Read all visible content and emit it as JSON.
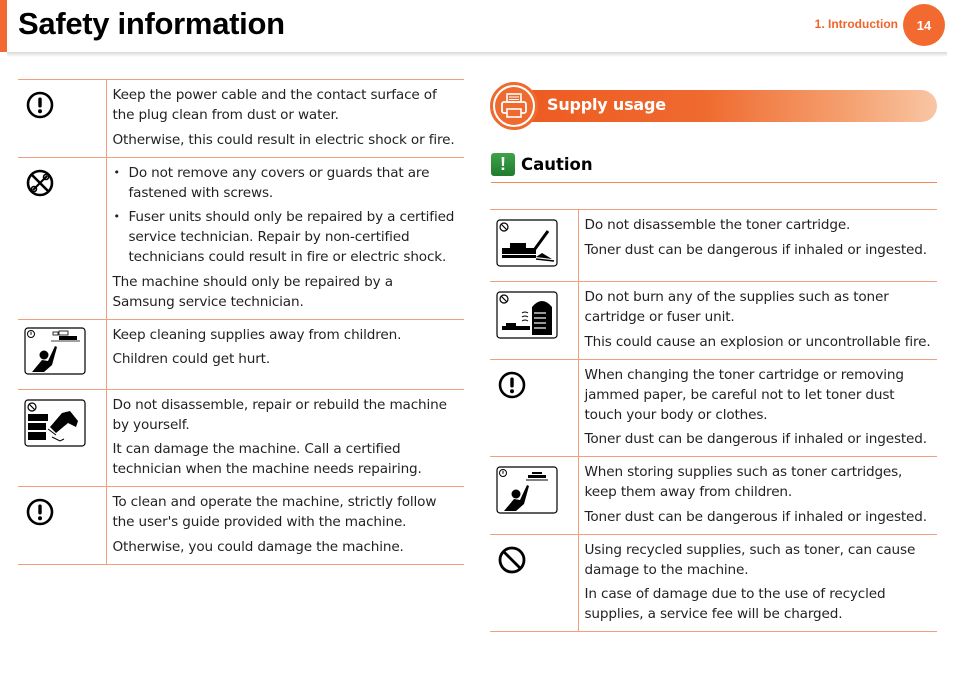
{
  "header": {
    "title": "Safety information",
    "chapter": "1.  Introduction",
    "page_number": "14",
    "accent_color": "#f26a30"
  },
  "left_table": {
    "rows": [
      {
        "icon": "mandatory-exclamation-icon",
        "paragraphs": [
          "Keep the power cable and the contact surface of the plug clean from dust or water.",
          "Otherwise, this could result in electric shock or fire."
        ]
      },
      {
        "icon": "no-tools-icon",
        "bullets": [
          "Do not remove any covers or guards that are fastened with screws.",
          "Fuser units should only be repaired by a certified service technician. Repair by non-certified technicians could result in fire or electric shock."
        ],
        "paragraphs": [
          "The machine should only be repaired by a Samsung service technician."
        ]
      },
      {
        "icon": "keep-away-from-children-icon",
        "paragraphs": [
          "Keep cleaning supplies away from children.",
          "Children could get hurt."
        ]
      },
      {
        "icon": "no-disassemble-machine-icon",
        "paragraphs": [
          "Do not disassemble, repair or rebuild the machine by yourself.",
          "It can damage the machine. Call a certified technician when the machine needs repairing."
        ]
      },
      {
        "icon": "mandatory-exclamation-icon",
        "paragraphs": [
          "To clean and operate the machine, strictly follow the user's guide provided with the machine.",
          "Otherwise, you could damage the machine."
        ]
      }
    ]
  },
  "section": {
    "title": "Supply usage",
    "icon": "printer-icon",
    "caution_label": "Caution",
    "caution_icon": "caution-exclamation-icon"
  },
  "right_table": {
    "rows": [
      {
        "icon": "no-disassemble-toner-icon",
        "paragraphs": [
          "Do not disassemble the toner cartridge.",
          "Toner dust can be dangerous if inhaled or ingested."
        ]
      },
      {
        "icon": "no-burn-supplies-icon",
        "paragraphs": [
          "Do not burn any of the supplies such as toner cartridge or fuser unit.",
          "This could cause an explosion or uncontrollable fire."
        ]
      },
      {
        "icon": "mandatory-exclamation-icon",
        "paragraphs": [
          "When changing the toner cartridge or removing jammed paper, be careful not to let toner dust touch your body or clothes.",
          "Toner dust can be dangerous if inhaled or ingested."
        ]
      },
      {
        "icon": "keep-toner-from-children-icon",
        "paragraphs": [
          "When storing supplies such as toner cartridges, keep them away from children.",
          "Toner dust can be dangerous if inhaled or ingested."
        ]
      },
      {
        "icon": "prohibited-icon",
        "paragraphs": [
          "Using recycled supplies, such as toner, can cause damage to the machine.",
          "In case of damage due to the use of recycled supplies, a service fee will be charged."
        ]
      }
    ]
  }
}
